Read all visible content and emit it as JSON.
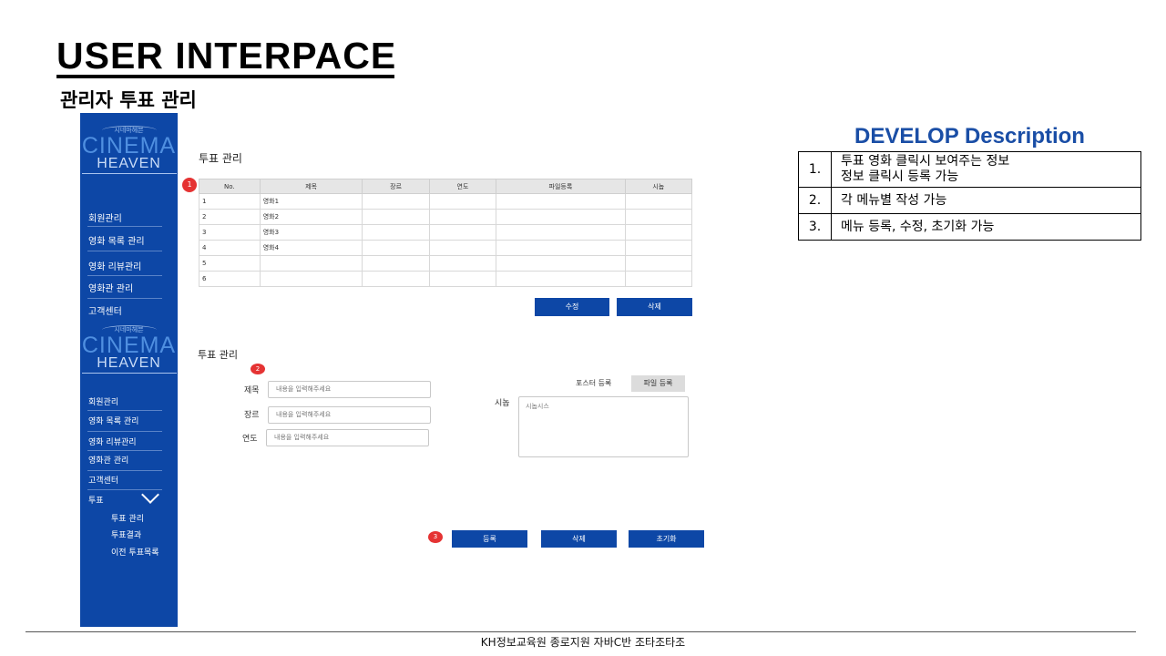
{
  "slide": {
    "title": "USER INTERPACE",
    "subtitle": "관리자 투표 관리",
    "footer": "KH정보교육원 종로지원 자바C반 조타조타조"
  },
  "sidebar": {
    "logo_arc": "시네마헤븐",
    "logo_main": "CINEMA",
    "logo_sub": "HEAVEN",
    "menu_top": [
      "회원관리",
      "영화 목록 관리",
      "영화 리뷰관리",
      "영화관 관리",
      "고객센터"
    ],
    "menu_bottom": [
      "회원관리",
      "영화 목록 관리",
      "영화 리뷰관리",
      "영화관 관리",
      "고객센터",
      "투표"
    ],
    "vote_sub": [
      "투표 관리",
      "투표결과",
      "이전 투표목록"
    ]
  },
  "list_panel": {
    "title": "투표 관리",
    "badge": "1",
    "columns": [
      "No.",
      "제목",
      "장르",
      "연도",
      "파일등록",
      "시놉"
    ],
    "rows": [
      [
        "1",
        "영화1",
        "",
        "",
        "",
        ""
      ],
      [
        "2",
        "영화2",
        "",
        "",
        "",
        ""
      ],
      [
        "3",
        "영화3",
        "",
        "",
        "",
        ""
      ],
      [
        "4",
        "영화4",
        "",
        "",
        "",
        ""
      ],
      [
        "5",
        "",
        "",
        "",
        "",
        ""
      ],
      [
        "6",
        "",
        "",
        "",
        "",
        ""
      ]
    ],
    "edit_label": "수정",
    "delete_label": "삭제"
  },
  "form_panel": {
    "title": "투표 관리",
    "badge_form": "2",
    "badge_buttons": "3",
    "title_label": "제목",
    "title_placeholder": "내용을 입력해주세요",
    "genre_label": "장르",
    "genre_placeholder": "내용을 입력해주세요",
    "year_label": "연도",
    "year_placeholder": "내용을 입력해주세요",
    "poster_label": "포스터 등록",
    "file_button": "파일 등록",
    "synopsis_label": "시놉",
    "synopsis_placeholder": "시놉시스",
    "register_label": "등록",
    "delete_label": "삭제",
    "reset_label": "초기화"
  },
  "develop": {
    "title": "DEVELOP Description",
    "items": [
      {
        "num": "1.",
        "line1": "투표 영화 클릭시 보여주는 정보",
        "line2": "정보 클릭시 등록 가능"
      },
      {
        "num": "2.",
        "line1": "각 메뉴별 작성 가능",
        "line2": ""
      },
      {
        "num": "3.",
        "line1": "메뉴 등록, 수정, 초기화 가능",
        "line2": ""
      }
    ]
  },
  "colors": {
    "sidebar_bg": "#0d47a6",
    "button_bg": "#0d47a6",
    "badge": "#e53333",
    "develop_title": "#1a4ea6"
  }
}
